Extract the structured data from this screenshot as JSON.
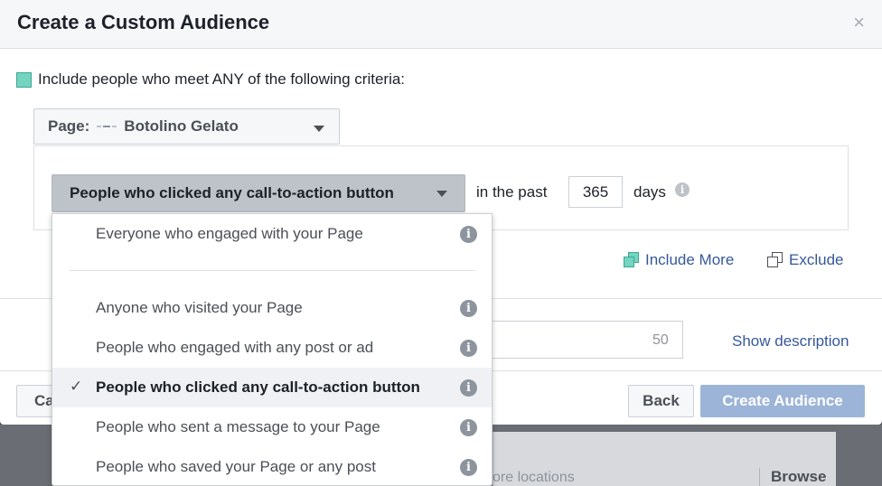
{
  "dialog": {
    "title": "Create a Custom Audience",
    "close_symbol": "×"
  },
  "criteria": {
    "text": "Include people who meet ANY of the following criteria:",
    "color": "#74d4c0"
  },
  "page_select": {
    "label": "Page:",
    "value": "Botolino Gelato"
  },
  "event_select": {
    "value": "People who clicked any call-to-action button"
  },
  "retention": {
    "prefix": "in the past",
    "days_value": "365",
    "suffix": "days",
    "info_symbol": "i"
  },
  "actions": {
    "include_more": "Include More",
    "exclude": "Exclude"
  },
  "audience_name": {
    "char_count": "50",
    "show_description": "Show description"
  },
  "footer": {
    "cancel": "Cancel",
    "back": "Back",
    "create": "Create Audience"
  },
  "menu": {
    "check_symbol": "✓",
    "info_symbol": "i",
    "items": [
      {
        "label": "Everyone who engaged with your Page"
      },
      {
        "label": "Anyone who visited your Page"
      },
      {
        "label": "People who engaged with any post or ad"
      },
      {
        "label": "People who clicked any call-to-action button",
        "selected": true
      },
      {
        "label": "People who sent a message to your Page"
      },
      {
        "label": "People who saved your Page or any post"
      }
    ]
  },
  "background": {
    "locations_text": "ore locations",
    "browse": "Browse"
  },
  "colors": {
    "accent_link": "#365899",
    "primary_button_disabled": "#9cb4d8",
    "selected_dropdown_bg": "#bec3c9"
  }
}
